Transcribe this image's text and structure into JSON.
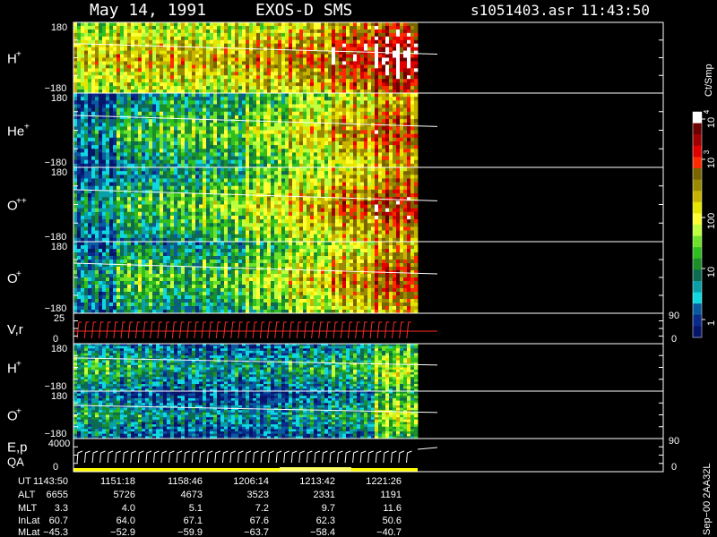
{
  "header": {
    "date": "May 14, 1991",
    "instrument": "EXOS-D SMS",
    "file": "s1051403.asr",
    "time": "11:43:50"
  },
  "panels": [
    {
      "id": "hplus1",
      "label": "H",
      "sup": "+",
      "ytop": "180",
      "ybot": "−180"
    },
    {
      "id": "heplus",
      "label": "He",
      "sup": "+",
      "ytop": "180",
      "ybot": "−180"
    },
    {
      "id": "oplusplus",
      "label": "O",
      "sup": "++",
      "ytop": "180",
      "ybot": "−180"
    },
    {
      "id": "oplus1",
      "label": "O",
      "sup": "+",
      "ytop": "180",
      "ybot": "−180"
    },
    {
      "id": "vr",
      "label": "V,r",
      "sup": "",
      "ytop": "25",
      "ybot": "0",
      "rtop": "90",
      "rbot": "0"
    },
    {
      "id": "hplus2",
      "label": "H",
      "sup": "+",
      "ytop": "180",
      "ybot": "−180"
    },
    {
      "id": "oplus2",
      "label": "O",
      "sup": "+",
      "ytop": "180",
      "ybot": "−180"
    },
    {
      "id": "ep",
      "label": "E,p",
      "sup": "",
      "label2": "QA",
      "ytop": "4000",
      "ybot": "0",
      "rtop": "90",
      "rbot": "0"
    }
  ],
  "colorbar": {
    "unit": "Ct/Smp",
    "ticks": [
      {
        "base": "10",
        "exp": "4"
      },
      {
        "base": "10",
        "exp": "3"
      },
      {
        "base": "100",
        "exp": ""
      },
      {
        "base": "10",
        "exp": ""
      },
      {
        "base": "1",
        "exp": ""
      }
    ],
    "colors": [
      "#ffffff",
      "#6b0000",
      "#a00000",
      "#e00000",
      "#ff2a00",
      "#7a6400",
      "#9a8a00",
      "#c8b400",
      "#e6e600",
      "#ffff33",
      "#bfff3d",
      "#6ee22a",
      "#2fbf1e",
      "#1a8f2a",
      "#0c6b52",
      "#0a9fa8",
      "#10d8e0",
      "#0a5aa0",
      "#0a2a8c",
      "#06146a"
    ]
  },
  "ephemeris": {
    "row_labels": [
      "UT",
      "ALT",
      "MLT",
      "InLat",
      "MLat"
    ],
    "columns": [
      [
        "1143:50",
        "6655",
        "3.3",
        "60.7",
        "−45.3"
      ],
      [
        "1151:18",
        "5726",
        "4.0",
        "64.0",
        "−52.9"
      ],
      [
        "1158:46",
        "4673",
        "5.1",
        "67.1",
        "−59.9"
      ],
      [
        "1206:14",
        "3523",
        "7.2",
        "67.6",
        "−63.7"
      ],
      [
        "1213:42",
        "2331",
        "9.7",
        "62.3",
        "−58.4"
      ],
      [
        "1221:26",
        "1191",
        "11.6",
        "50.6",
        "−40.7"
      ]
    ]
  },
  "footer_code": "Sep−00  2AA32L",
  "chart_data": {
    "type": "heatmap",
    "title": "May 14, 1991   EXOS-D SMS",
    "x_ticks": [
      "1143:50",
      "1151:18",
      "1158:46",
      "1206:14",
      "1213:42",
      "1221:26"
    ],
    "series": [
      {
        "name": "H+",
        "ylim": [
          -180,
          180
        ],
        "intensity_profile": [
          0.55,
          0.6,
          0.6,
          0.6,
          0.65,
          0.7,
          0.8,
          0.9
        ]
      },
      {
        "name": "He+",
        "ylim": [
          -180,
          180
        ],
        "intensity_profile": [
          0.15,
          0.3,
          0.35,
          0.35,
          0.45,
          0.55,
          0.65,
          0.75
        ]
      },
      {
        "name": "O++",
        "ylim": [
          -180,
          180
        ],
        "intensity_profile": [
          0.2,
          0.3,
          0.35,
          0.4,
          0.5,
          0.6,
          0.7,
          0.78
        ]
      },
      {
        "name": "O+",
        "ylim": [
          -180,
          180
        ],
        "intensity_profile": [
          0.2,
          0.35,
          0.3,
          0.35,
          0.45,
          0.55,
          0.65,
          0.75
        ]
      },
      {
        "name": "H+ (2)",
        "ylim": [
          -180,
          180
        ],
        "intensity_profile": [
          0.3,
          0.25,
          0.2,
          0.2,
          0.2,
          0.25,
          0.3,
          0.45
        ]
      },
      {
        "name": "O+ (2)",
        "ylim": [
          -180,
          180
        ],
        "intensity_profile": [
          0.25,
          0.2,
          0.15,
          0.15,
          0.15,
          0.2,
          0.25,
          0.45
        ]
      }
    ],
    "data_coverage_fraction": 0.82,
    "colorbar_scale": "log",
    "colorbar_range": [
      1,
      10000
    ]
  }
}
